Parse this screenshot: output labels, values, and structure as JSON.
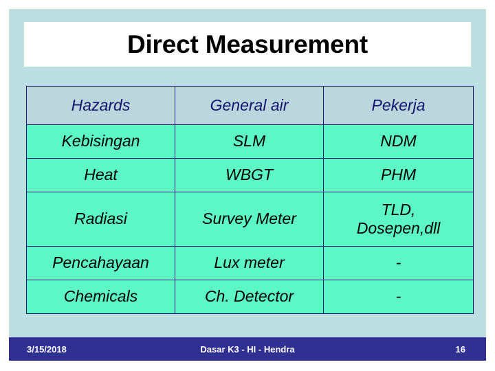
{
  "slide": {
    "title": "Direct Measurement",
    "background_color": "#bcdde2",
    "title_band_color": "#ffffff",
    "accent_header_color": "#bcd6de",
    "accent_cell_color": "#5cf7c4",
    "header_text_color": "#141470",
    "footer_color": "#302f92"
  },
  "table": {
    "headers": [
      "Hazards",
      "General air",
      "Pekerja"
    ],
    "rows": [
      {
        "hazard": "Kebisingan",
        "general_air": "SLM",
        "pekerja": "NDM"
      },
      {
        "hazard": "Heat",
        "general_air": "WBGT",
        "pekerja": "PHM"
      },
      {
        "hazard": "Radiasi",
        "general_air": "Survey Meter",
        "pekerja_line1": "TLD,",
        "pekerja_line2": "Dosepen,dll"
      },
      {
        "hazard": "Pencahayaan",
        "general_air": "Lux meter",
        "pekerja": "-"
      },
      {
        "hazard": "Chemicals",
        "general_air": "Ch. Detector",
        "pekerja": "-"
      }
    ]
  },
  "footer": {
    "date": "3/15/2018",
    "center": "Dasar K3 - HI - Hendra",
    "page": "16"
  }
}
